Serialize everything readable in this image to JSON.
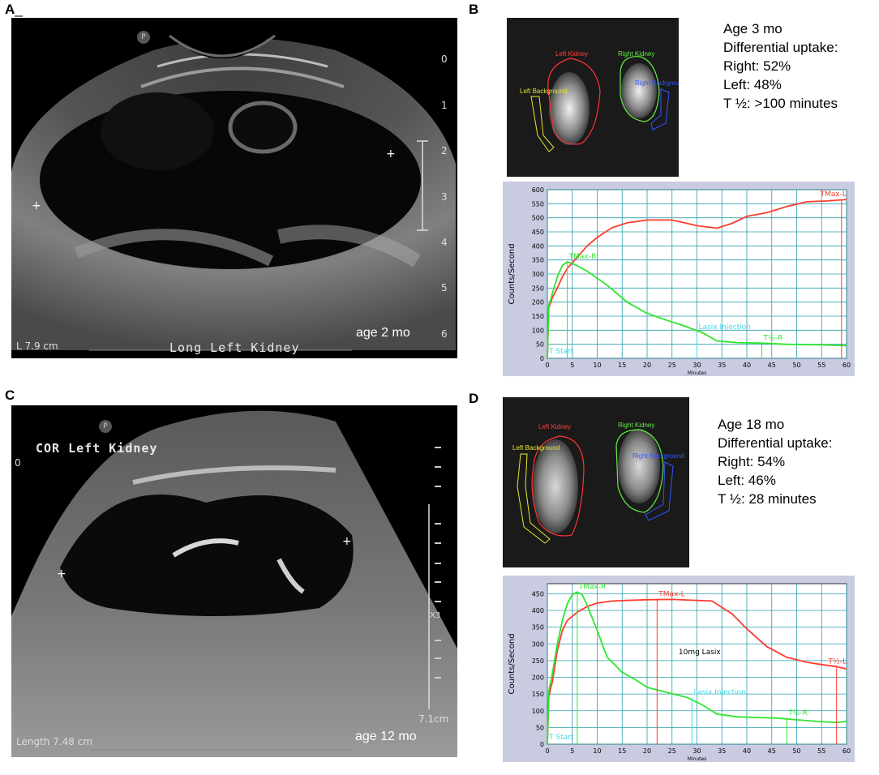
{
  "panels": {
    "a": {
      "letter": "A",
      "label_right": "age 2 mo",
      "length_label": "L 7.9 cm",
      "view_label": "Long Left Kidney",
      "probe_icon": "P",
      "depth_ticks": [
        "0",
        "1",
        "2",
        "3",
        "4",
        "5",
        "6"
      ]
    },
    "b": {
      "letter": "B",
      "info": {
        "age": "Age 3 mo",
        "uptake_title": "Differential uptake:",
        "right": "Right: 52%",
        "left": "Left: 48%",
        "half": "T ½: >100 minutes"
      },
      "roi": {
        "left_kidney": "Left Kidney",
        "right_kidney": "Right Kidney",
        "left_bg": "Left Background",
        "right_bg": "Right Background"
      }
    },
    "c": {
      "letter": "C",
      "label_right": "age 12 mo",
      "length_label": "Length 7.48 cm",
      "view_label": "COR Left Kidney",
      "depth_label": "7.1cm",
      "zero": "0",
      "marker": "X3",
      "probe_icon": "P"
    },
    "d": {
      "letter": "D",
      "info": {
        "age": "Age 18 mo",
        "uptake_title": "Differential uptake:",
        "right": "Right: 54%",
        "left": "Left: 46%",
        "half": "T ½: 28 minutes"
      },
      "roi": {
        "left_kidney": "Left Kidney",
        "right_kidney": "Right Kidney",
        "left_bg": "Left Background",
        "right_bg": "Right Background"
      }
    }
  },
  "chart_data": [
    {
      "type": "line",
      "ylabel": "Counts/Second",
      "xlabel": "Minutes",
      "xlim": [
        0,
        60
      ],
      "ylim": [
        0,
        600
      ],
      "xticks": [
        0,
        5,
        10,
        15,
        20,
        25,
        30,
        35,
        40,
        45,
        50,
        55,
        60
      ],
      "yticks": [
        0,
        50,
        100,
        150,
        200,
        250,
        300,
        350,
        400,
        450,
        500,
        550,
        600
      ],
      "colors": {
        "left": "#ff3b2f",
        "right": "#2ee62e",
        "annot": "#44d7e8"
      },
      "series": [
        {
          "name": "Left",
          "points": [
            [
              0,
              0
            ],
            [
              0.3,
              180
            ],
            [
              0.7,
              200
            ],
            [
              1,
              215
            ],
            [
              2,
              250
            ],
            [
              3,
              290
            ],
            [
              4,
              320
            ],
            [
              6,
              360
            ],
            [
              8,
              400
            ],
            [
              10,
              430
            ],
            [
              13,
              465
            ],
            [
              16,
              482
            ],
            [
              20,
              492
            ],
            [
              25,
              492
            ],
            [
              30,
              472
            ],
            [
              34,
              463
            ],
            [
              37,
              480
            ],
            [
              40,
              505
            ],
            [
              44,
              518
            ],
            [
              48,
              540
            ],
            [
              52,
              557
            ],
            [
              56,
              560
            ],
            [
              60,
              565
            ]
          ]
        },
        {
          "name": "Right",
          "points": [
            [
              0,
              0
            ],
            [
              0.3,
              190
            ],
            [
              0.7,
              210
            ],
            [
              1,
              230
            ],
            [
              2,
              290
            ],
            [
              3,
              330
            ],
            [
              4,
              343
            ],
            [
              5,
              338
            ],
            [
              8,
              310
            ],
            [
              12,
              260
            ],
            [
              16,
              200
            ],
            [
              20,
              160
            ],
            [
              24,
              135
            ],
            [
              27,
              118
            ],
            [
              31,
              92
            ],
            [
              34,
              62
            ],
            [
              38,
              56
            ],
            [
              43,
              54
            ],
            [
              48,
              50
            ],
            [
              55,
              48
            ],
            [
              60,
              45
            ]
          ]
        }
      ],
      "annotations": [
        {
          "text": "TMax-L",
          "x": 59,
          "y": 565,
          "color": "left"
        },
        {
          "text": "TMax-R",
          "x": 4,
          "y": 343,
          "color": "right"
        },
        {
          "text": "Lasix Injection",
          "x": 30,
          "y": 92,
          "color": "annot"
        },
        {
          "text": "T½-R",
          "x": 43,
          "y": 54,
          "color": "right"
        },
        {
          "text": "T Start",
          "x": 0,
          "y": 0,
          "color": "annot"
        }
      ]
    },
    {
      "type": "line",
      "ylabel": "Counts/Second",
      "xlabel": "Minutes",
      "xlim": [
        0,
        60
      ],
      "ylim": [
        0,
        480
      ],
      "xticks": [
        0,
        5,
        10,
        15,
        20,
        25,
        30,
        35,
        40,
        45,
        50,
        55,
        60
      ],
      "yticks": [
        0,
        50,
        100,
        150,
        200,
        250,
        300,
        350,
        400,
        450
      ],
      "colors": {
        "left": "#ff3b2f",
        "right": "#2ee62e",
        "annot": "#44d7e8"
      },
      "series": [
        {
          "name": "Left",
          "points": [
            [
              0,
              0
            ],
            [
              0.3,
              140
            ],
            [
              0.7,
              170
            ],
            [
              1,
              185
            ],
            [
              2,
              280
            ],
            [
              3,
              340
            ],
            [
              4,
              370
            ],
            [
              6,
              395
            ],
            [
              8,
              412
            ],
            [
              10,
              422
            ],
            [
              13,
              428
            ],
            [
              16,
              430
            ],
            [
              20,
              432
            ],
            [
              25,
              433
            ],
            [
              30,
              430
            ],
            [
              33,
              428
            ],
            [
              37,
              390
            ],
            [
              40,
              345
            ],
            [
              44,
              292
            ],
            [
              48,
              260
            ],
            [
              52,
              245
            ],
            [
              55,
              238
            ],
            [
              58,
              232
            ],
            [
              60,
              225
            ]
          ]
        },
        {
          "name": "Right",
          "points": [
            [
              0,
              0
            ],
            [
              0.3,
              160
            ],
            [
              1,
              210
            ],
            [
              2,
              300
            ],
            [
              3,
              370
            ],
            [
              4,
              420
            ],
            [
              5,
              447
            ],
            [
              6,
              455
            ],
            [
              7,
              447
            ],
            [
              8,
              415
            ],
            [
              10,
              340
            ],
            [
              12,
              260
            ],
            [
              15,
              215
            ],
            [
              18,
              190
            ],
            [
              20,
              170
            ],
            [
              24,
              155
            ],
            [
              28,
              140
            ],
            [
              31,
              118
            ],
            [
              34,
              90
            ],
            [
              38,
              82
            ],
            [
              42,
              80
            ],
            [
              46,
              78
            ],
            [
              50,
              73
            ],
            [
              54,
              68
            ],
            [
              58,
              65
            ],
            [
              60,
              68
            ]
          ]
        }
      ],
      "annotations": [
        {
          "text": "TMax-L",
          "x": 22,
          "y": 433,
          "color": "left"
        },
        {
          "text": "TMax-R",
          "x": 6,
          "y": 455,
          "color": "right"
        },
        {
          "text": "10mg Lasix",
          "x": 26,
          "y": 260,
          "color": "black"
        },
        {
          "text": "Lasix Injection",
          "x": 29,
          "y": 140,
          "color": "annot"
        },
        {
          "text": "T½-L",
          "x": 58,
          "y": 232,
          "color": "left"
        },
        {
          "text": "T½-R",
          "x": 48,
          "y": 78,
          "color": "right"
        },
        {
          "text": "T Start",
          "x": 0,
          "y": 0,
          "color": "annot"
        }
      ]
    }
  ]
}
